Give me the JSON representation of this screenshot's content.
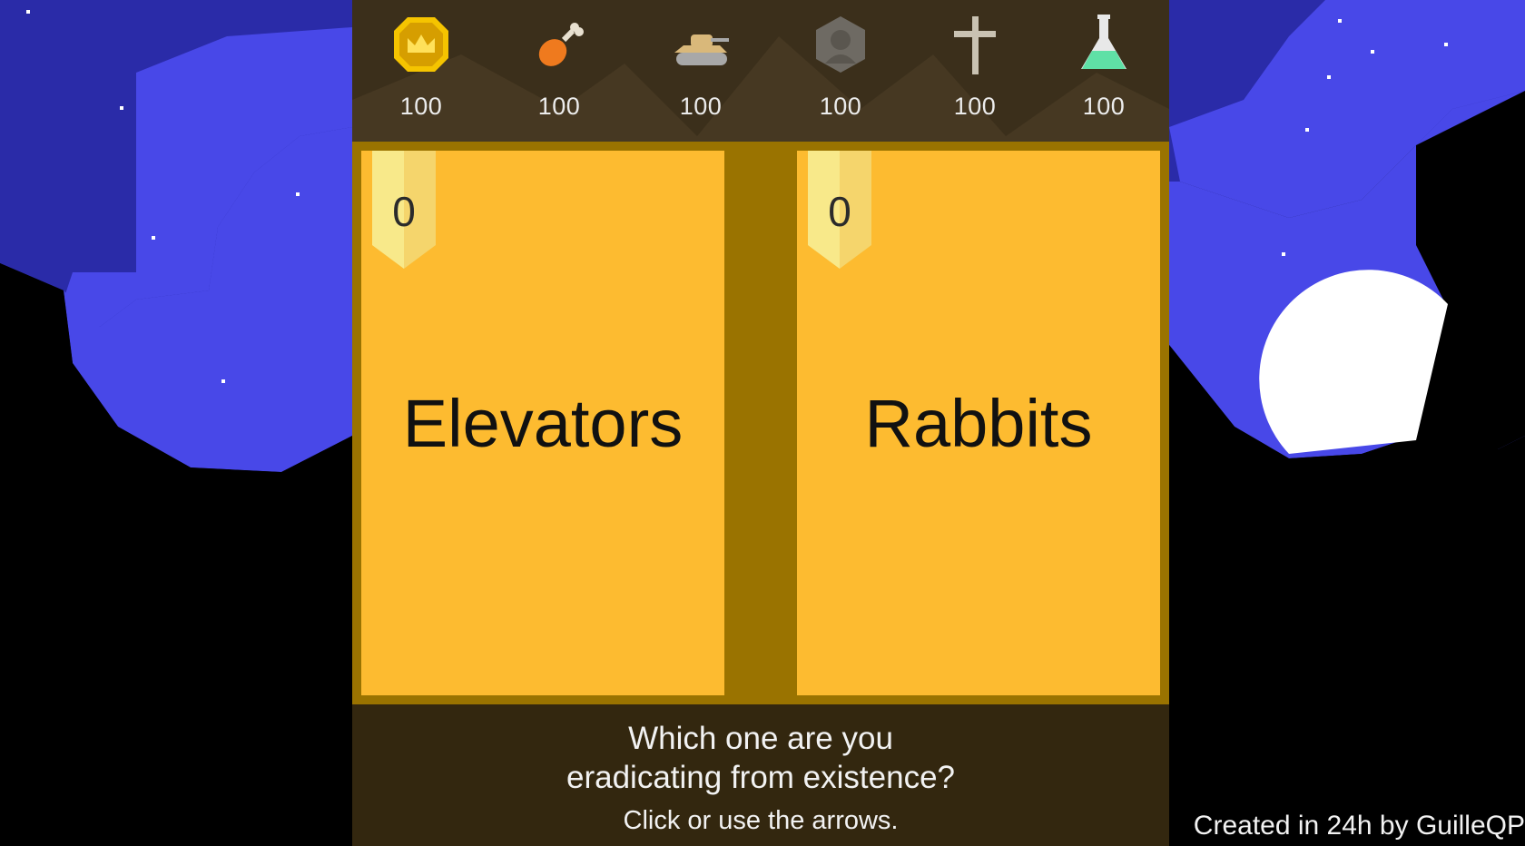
{
  "stats": [
    {
      "icon": "crown-coin-icon",
      "value": "100"
    },
    {
      "icon": "drumstick-icon",
      "value": "100"
    },
    {
      "icon": "tank-icon",
      "value": "100"
    },
    {
      "icon": "hexagon-person-icon",
      "value": "100"
    },
    {
      "icon": "cross-icon",
      "value": "100"
    },
    {
      "icon": "flask-icon",
      "value": "100"
    }
  ],
  "cards": {
    "left": {
      "score": "0",
      "label": "Elevators"
    },
    "right": {
      "score": "0",
      "label": "Rabbits"
    }
  },
  "prompt": {
    "line1": "Which one are you",
    "line2": "eradicating from existence?",
    "hint": "Click or use the arrows."
  },
  "credit": "Created in 24h by GuilleQP",
  "colors": {
    "sky_dark": "#2a2ba8",
    "sky_light": "#4848e8",
    "card": "#fdbb30",
    "card_border": "#9a7300",
    "panel": "#3a2d18"
  }
}
